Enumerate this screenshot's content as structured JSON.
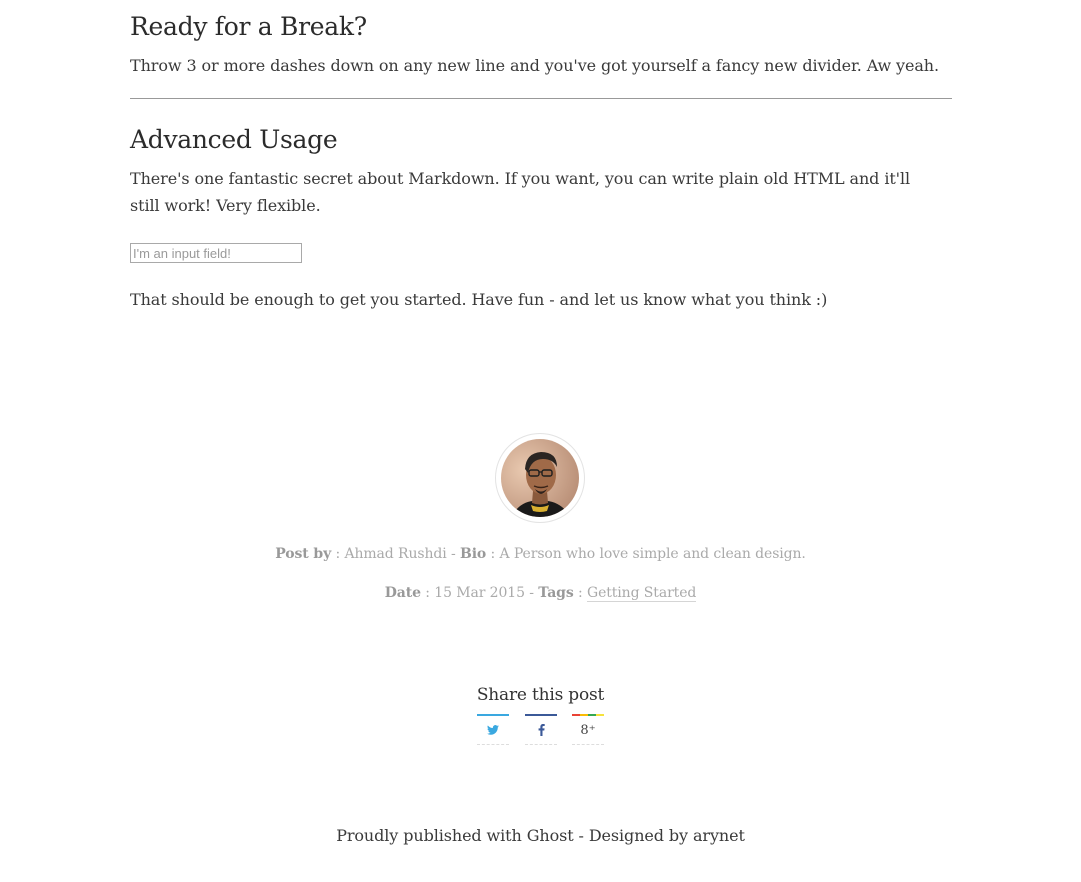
{
  "article": {
    "break_heading": "Ready for a Break?",
    "break_text": "Throw 3 or more dashes down on any new line and you've got yourself a fancy new divider. Aw yeah.",
    "advanced_heading": "Advanced Usage",
    "advanced_text": "There's one fantastic secret about Markdown. If you want, you can write plain old HTML and it'll still work! Very flexible.",
    "input_placeholder": "I'm an input field!",
    "closing_text": "That should be enough to get you started. Have fun - and let us know what you think :)"
  },
  "author": {
    "post_by_label": "Post by",
    "name": "Ahmad Rushdi",
    "bio_label": "Bio",
    "bio": "A Person who love simple and clean design.",
    "date_label": "Date",
    "date": "15 Mar 2015",
    "tags_label": "Tags",
    "tag": "Getting Started",
    "separator_colon": " : ",
    "separator_dash": " - "
  },
  "share": {
    "title": "Share this post",
    "buttons": [
      {
        "name": "twitter",
        "icon": "twitter-icon",
        "color": "#3aa8e0"
      },
      {
        "name": "facebook",
        "icon": "facebook-icon",
        "color": "#3b5998"
      },
      {
        "name": "google-plus",
        "icon": "google-plus-icon",
        "label": "8⁺"
      }
    ]
  },
  "footer": {
    "text": "Proudly published with Ghost - Designed by arynet"
  }
}
